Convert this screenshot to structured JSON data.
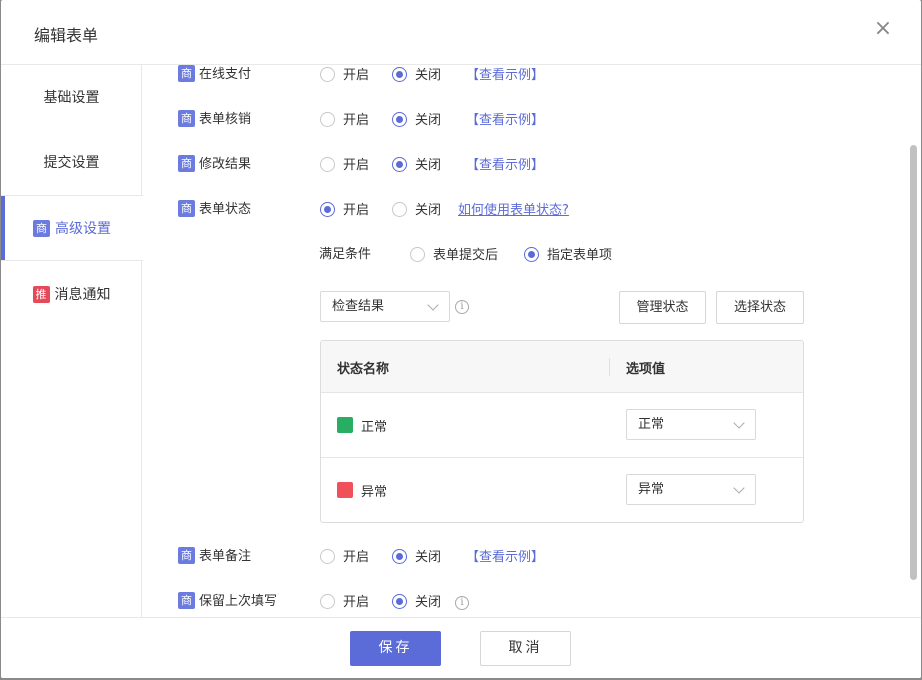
{
  "dialog": {
    "title": "编辑表单",
    "close_icon": "×"
  },
  "sidebar": {
    "items": [
      {
        "label": "基础设置"
      },
      {
        "label": "提交设置"
      },
      {
        "label": "高级设置",
        "badge": "商",
        "active": true
      },
      {
        "label": "消息通知",
        "badge": "推"
      }
    ]
  },
  "settings": {
    "online_pay": {
      "badge": "商",
      "label": "在线支付",
      "opt_on": "开启",
      "opt_off": "关闭",
      "value": "关闭",
      "link": "【查看示例】"
    },
    "verify": {
      "badge": "商",
      "label": "表单核销",
      "opt_on": "开启",
      "opt_off": "关闭",
      "value": "关闭",
      "link": "【查看示例】"
    },
    "edit_result": {
      "badge": "商",
      "label": "修改结果",
      "opt_on": "开启",
      "opt_off": "关闭",
      "value": "关闭",
      "link": "【查看示例】"
    },
    "form_status": {
      "badge": "商",
      "label": "表单状态",
      "opt_on": "开启",
      "opt_off": "关闭",
      "value": "开启",
      "link": "如何使用表单状态?"
    },
    "remark": {
      "badge": "商",
      "label": "表单备注",
      "opt_on": "开启",
      "opt_off": "关闭",
      "value": "关闭",
      "link": "【查看示例】"
    },
    "keep_last": {
      "badge": "商",
      "label": "保留上次填写",
      "opt_on": "开启",
      "opt_off": "关闭",
      "value": "关闭",
      "info_icon": "i"
    }
  },
  "condition": {
    "label": "满足条件",
    "opt_after_submit": "表单提交后",
    "opt_specified": "指定表单项",
    "value": "指定表单项",
    "field_select": "检查结果",
    "info_icon": "i",
    "manage_btn": "管理状态",
    "choose_btn": "选择状态"
  },
  "status_table": {
    "headers": [
      "状态名称",
      "选项值"
    ],
    "rows": [
      {
        "name": "正常",
        "color": "#27ae60",
        "option": "正常"
      },
      {
        "name": "异常",
        "color": "#f0505a",
        "option": "异常"
      }
    ]
  },
  "footer": {
    "save": "保存",
    "cancel": "取消"
  }
}
